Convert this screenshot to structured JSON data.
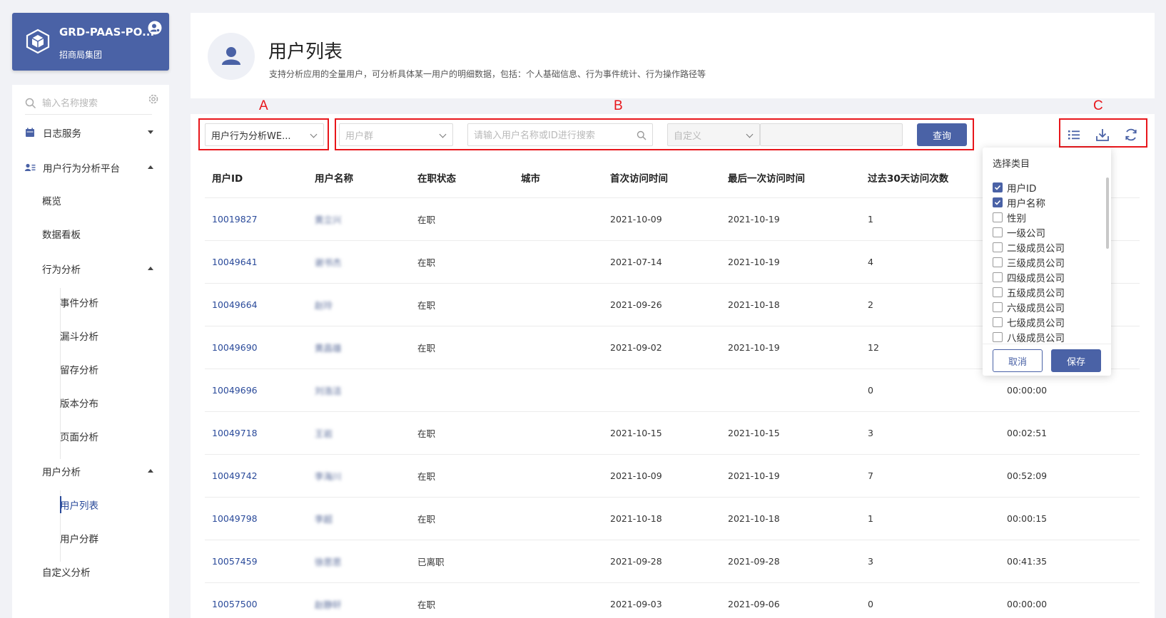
{
  "brand": {
    "title": "GRD-PAAS-PO...",
    "subtitle": "招商局集团"
  },
  "sidebar": {
    "search_placeholder": "输入名称搜索",
    "items": [
      {
        "label": "日志服务"
      },
      {
        "label": "用户行为分析平台"
      },
      {
        "label": "概览"
      },
      {
        "label": "数据看板"
      },
      {
        "label": "行为分析"
      },
      {
        "label": "事件分析"
      },
      {
        "label": "漏斗分析"
      },
      {
        "label": "留存分析"
      },
      {
        "label": "版本分布"
      },
      {
        "label": "页面分析"
      },
      {
        "label": "用户分析"
      },
      {
        "label": "用户列表"
      },
      {
        "label": "用户分群"
      },
      {
        "label": "自定义分析"
      }
    ]
  },
  "header": {
    "title": "用户列表",
    "description": "支持分析应用的全量用户，可分析具体某一用户的明细数据，包括：个人基础信息、行为事件统计、行为操作路径等"
  },
  "annotations": {
    "a": "A",
    "b": "B",
    "c": "C"
  },
  "filters": {
    "app_select": "用户行为分析WE...",
    "group_placeholder": "用户群",
    "search_placeholder": "请输入用户名称或ID进行搜索",
    "custom_placeholder": "自定义",
    "query_label": "查询"
  },
  "table": {
    "columns": [
      "用户ID",
      "用户名称",
      "在职状态",
      "城市",
      "首次访问时间",
      "最后一次访问时间",
      "过去30天访问次数"
    ],
    "rows": [
      {
        "id": "10019827",
        "name": "黄立兴",
        "status": "在职",
        "city": "",
        "first": "2021-10-09",
        "last": "2021-10-19",
        "visits": "1",
        "duration": ""
      },
      {
        "id": "10049641",
        "name": "谢书杰",
        "status": "在职",
        "city": "",
        "first": "2021-07-14",
        "last": "2021-10-19",
        "visits": "4",
        "duration": ""
      },
      {
        "id": "10049664",
        "name": "赵玲",
        "status": "在职",
        "city": "",
        "first": "2021-09-26",
        "last": "2021-10-18",
        "visits": "2",
        "duration": ""
      },
      {
        "id": "10049690",
        "name": "黄昌雄",
        "status": "在职",
        "city": "",
        "first": "2021-09-02",
        "last": "2021-10-19",
        "visits": "12",
        "duration": ""
      },
      {
        "id": "10049696",
        "name": "刘浩洁",
        "status": "",
        "city": "",
        "first": "",
        "last": "",
        "visits": "0",
        "duration": "00:00:00"
      },
      {
        "id": "10049718",
        "name": "王岩",
        "status": "在职",
        "city": "",
        "first": "2021-10-15",
        "last": "2021-10-15",
        "visits": "3",
        "duration": "00:02:51"
      },
      {
        "id": "10049742",
        "name": "李海川",
        "status": "在职",
        "city": "",
        "first": "2021-10-09",
        "last": "2021-10-19",
        "visits": "7",
        "duration": "00:52:09"
      },
      {
        "id": "10049798",
        "name": "李超",
        "status": "在职",
        "city": "",
        "first": "2021-10-18",
        "last": "2021-10-18",
        "visits": "1",
        "duration": "00:00:15"
      },
      {
        "id": "10057459",
        "name": "徐思思",
        "status": "已离职",
        "city": "",
        "first": "2021-09-28",
        "last": "2021-09-28",
        "visits": "3",
        "duration": "00:41:35"
      },
      {
        "id": "10057500",
        "name": "赵静轩",
        "status": "在职",
        "city": "",
        "first": "2021-09-03",
        "last": "2021-09-06",
        "visits": "0",
        "duration": "00:00:00"
      }
    ]
  },
  "column_picker": {
    "title": "选择类目",
    "options": [
      {
        "label": "用户ID",
        "checked": true
      },
      {
        "label": "用户名称",
        "checked": true
      },
      {
        "label": "性别",
        "checked": false
      },
      {
        "label": "一级公司",
        "checked": false
      },
      {
        "label": "二级成员公司",
        "checked": false
      },
      {
        "label": "三级成员公司",
        "checked": false
      },
      {
        "label": "四级成员公司",
        "checked": false
      },
      {
        "label": "五级成员公司",
        "checked": false
      },
      {
        "label": "六级成员公司",
        "checked": false
      },
      {
        "label": "七级成员公司",
        "checked": false
      },
      {
        "label": "八级成员公司",
        "checked": false
      }
    ],
    "cancel_label": "取消",
    "save_label": "保存"
  },
  "colors": {
    "primary": "#4a62a6",
    "link": "#2a4a9a",
    "annotation": "#e8161b"
  }
}
